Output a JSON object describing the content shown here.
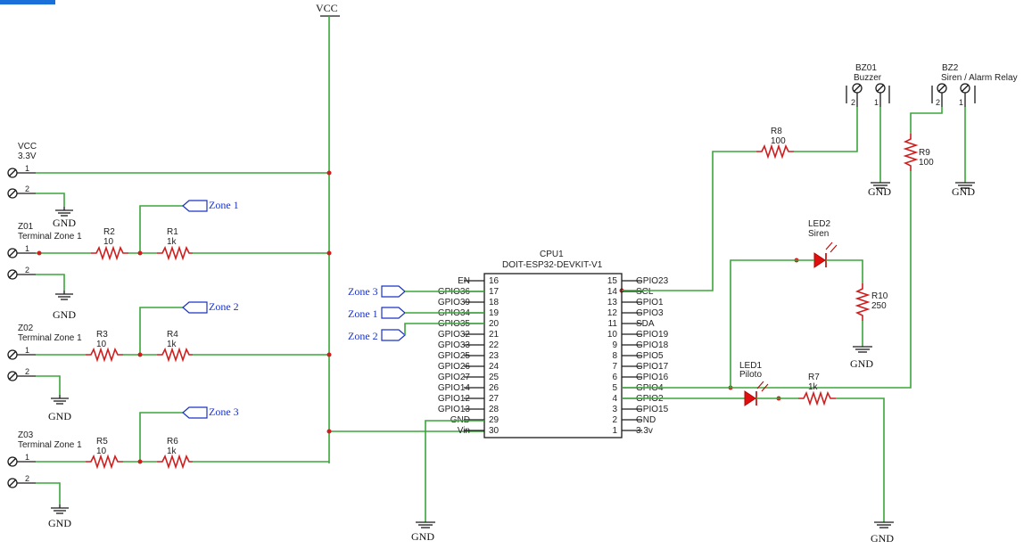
{
  "rails": {
    "vcc": "VCC",
    "gnd": "GND"
  },
  "connectors": [
    {
      "ref": "VCC",
      "value": "3.3V",
      "pin1": "1",
      "pin2": "2"
    },
    {
      "ref": "Z01",
      "value": "Terminal Zone 1",
      "pin1": "1",
      "pin2": "2"
    },
    {
      "ref": "Z02",
      "value": "Terminal Zone 1",
      "pin1": "1",
      "pin2": "2"
    },
    {
      "ref": "Z03",
      "value": "Terminal Zone 1",
      "pin1": "1",
      "pin2": "2"
    }
  ],
  "resistors": [
    {
      "ref": "R2",
      "value": "10"
    },
    {
      "ref": "R1",
      "value": "1k"
    },
    {
      "ref": "R3",
      "value": "10"
    },
    {
      "ref": "R4",
      "value": "1k"
    },
    {
      "ref": "R5",
      "value": "10"
    },
    {
      "ref": "R6",
      "value": "1k"
    },
    {
      "ref": "R8",
      "value": "100"
    },
    {
      "ref": "R9",
      "value": "100"
    },
    {
      "ref": "R10",
      "value": "250"
    },
    {
      "ref": "R7",
      "value": "1k"
    }
  ],
  "net_labels": [
    "Zone 1",
    "Zone 2",
    "Zone 3",
    "Zone 3",
    "Zone 1",
    "Zone 2"
  ],
  "cpu": {
    "ref": "CPU1",
    "model": "DOIT-ESP32-DEVKIT-V1",
    "left_pins": [
      {
        "name": "EN",
        "num": "16"
      },
      {
        "name": "GPIO36",
        "num": "17"
      },
      {
        "name": "GPIO39",
        "num": "18"
      },
      {
        "name": "GPIO34",
        "num": "19"
      },
      {
        "name": "GPIO35",
        "num": "20"
      },
      {
        "name": "GPIO32",
        "num": "21"
      },
      {
        "name": "GPIO33",
        "num": "22"
      },
      {
        "name": "GPIO25",
        "num": "23"
      },
      {
        "name": "GPIO26",
        "num": "24"
      },
      {
        "name": "GPIO27",
        "num": "25"
      },
      {
        "name": "GPIO14",
        "num": "26"
      },
      {
        "name": "GPIO12",
        "num": "27"
      },
      {
        "name": "GPIO13",
        "num": "28"
      },
      {
        "name": "GND",
        "num": "29"
      },
      {
        "name": "Vin",
        "num": "30"
      }
    ],
    "right_pins": [
      {
        "name": "GPIO23",
        "num": "15"
      },
      {
        "name": "SCL",
        "num": "14"
      },
      {
        "name": "GPIO1",
        "num": "13"
      },
      {
        "name": "GPIO3",
        "num": "12"
      },
      {
        "name": "SDA",
        "num": "11"
      },
      {
        "name": "GPIO19",
        "num": "10"
      },
      {
        "name": "GPIO18",
        "num": "9"
      },
      {
        "name": "GPIO5",
        "num": "8"
      },
      {
        "name": "GPIO17",
        "num": "7"
      },
      {
        "name": "GPIO16",
        "num": "6"
      },
      {
        "name": "GPIO4",
        "num": "5"
      },
      {
        "name": "GPIO2",
        "num": "4"
      },
      {
        "name": "GPIO15",
        "num": "3"
      },
      {
        "name": "GND",
        "num": "2"
      },
      {
        "name": "3.3v",
        "num": "1"
      }
    ]
  },
  "buzzers": [
    {
      "ref": "BZ01",
      "value": "Buzzer",
      "pin2": "2",
      "pin1": "1"
    },
    {
      "ref": "BZ2",
      "value": "Siren / Alarm Relay",
      "pin2": "2",
      "pin1": "1"
    }
  ],
  "leds": [
    {
      "ref": "LED2",
      "value": "Siren"
    },
    {
      "ref": "LED1",
      "value": "Piloto"
    }
  ],
  "colors": {
    "wire": "#3aa63a",
    "junction": "#cc1f1f",
    "net_label": "#1a32c8",
    "led": "#e01010"
  }
}
